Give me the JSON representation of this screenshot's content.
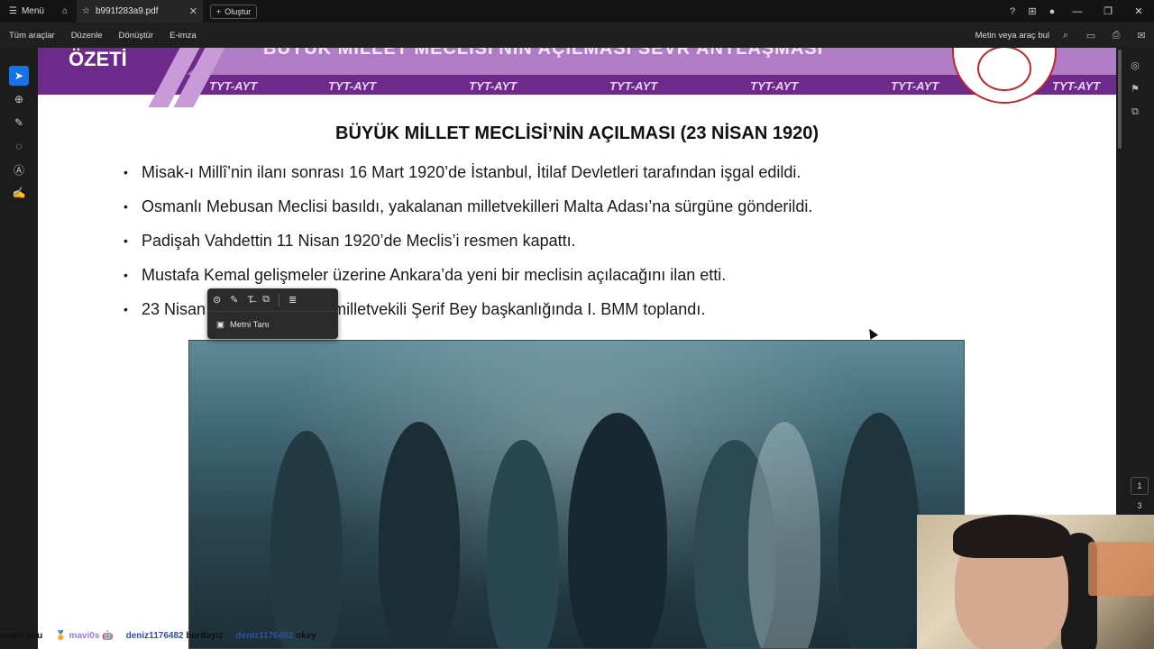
{
  "titlebar": {
    "menu_label": "Menü",
    "tab_title": "b991f283a9.pdf",
    "new_button_label": "Oluştur"
  },
  "toolbar": {
    "all_tools": "Tüm araçlar",
    "edit": "Düzenle",
    "convert": "Dönüştür",
    "esign": "E-imza",
    "find_label": "Metin veya araç bul"
  },
  "page_nav": {
    "current_page": "1",
    "total_pages": "3"
  },
  "document": {
    "banner_left": "ÖZETİ",
    "banner_title": "BÜYÜK MİLLET MECLİSİ'NİN AÇILMASI SEVR ANTLAŞMASI",
    "banner_tag": "TYT-AYT",
    "heading": "BÜYÜK MİLLET MECLİSİ’NİN AÇILMASI (23 NİSAN 1920)",
    "bullets": [
      "Misak-ı Millî’nin ilanı sonrası 16 Mart 1920’de İstanbul, İtilaf Devletleri tarafından işgal edildi.",
      "Osmanlı Mebusan Meclisi basıldı, yakalanan milletvekilleri Malta Adası’na sürgüne gönderildi.",
      "Padişah Vahdettin 11 Nisan 1920’de Meclis’i resmen kapattı.",
      "Mustafa Kemal gelişmeler üzerine Ankara’da yeni bir meclisin açılacağını ilan etti.",
      "23 Nisan 1920’de en yaşlı milletvekili Şerif Bey başkanlığında I. BMM toplandı."
    ]
  },
  "popup": {
    "ocr_label": "Metni Tanı"
  },
  "chat": {
    "msg0_text": "ocam onu",
    "user1": "mavi0s",
    "user2": "deniz1176482",
    "msg2": "burdayız",
    "user3": "deniz1176482",
    "msg3": "okey"
  }
}
